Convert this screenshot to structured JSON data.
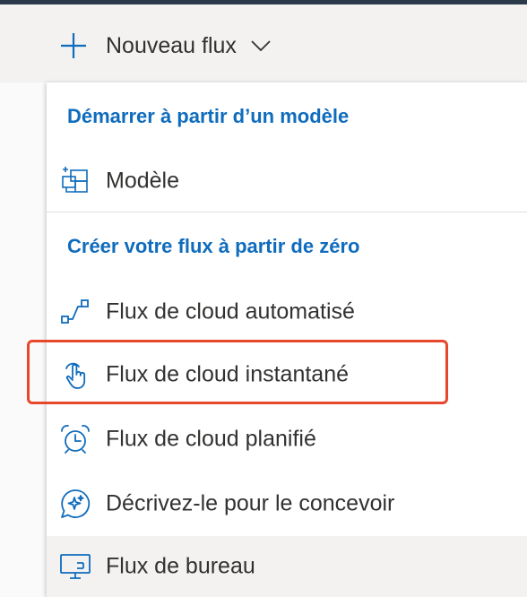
{
  "command_bar": {
    "new_flow_label": "Nouveau flux",
    "icons": {
      "plus": "plus-icon",
      "chevron": "chevron-down-icon"
    }
  },
  "menu": {
    "section_template": {
      "header": "Démarrer à partir d’un modèle",
      "items": [
        {
          "label": "Modèle",
          "icon": "template-icon"
        }
      ]
    },
    "section_scratch": {
      "header": "Créer votre flux à partir de zéro",
      "items": [
        {
          "label": "Flux de cloud automatisé",
          "icon": "automated-flow-icon"
        },
        {
          "label": "Flux de cloud instantané",
          "icon": "touch-hand-icon",
          "highlighted": true
        },
        {
          "label": "Flux de cloud planifié",
          "icon": "alarm-clock-icon"
        },
        {
          "label": "Décrivez-le pour le concevoir",
          "icon": "chat-sparkle-icon"
        },
        {
          "label": "Flux de bureau",
          "icon": "desktop-flow-icon",
          "hovered": true
        }
      ]
    }
  },
  "colors": {
    "accent": "#0f6cbd",
    "highlight_border": "#e8472c",
    "command_bar_bg": "#f3f2f1",
    "text": "#323130"
  }
}
